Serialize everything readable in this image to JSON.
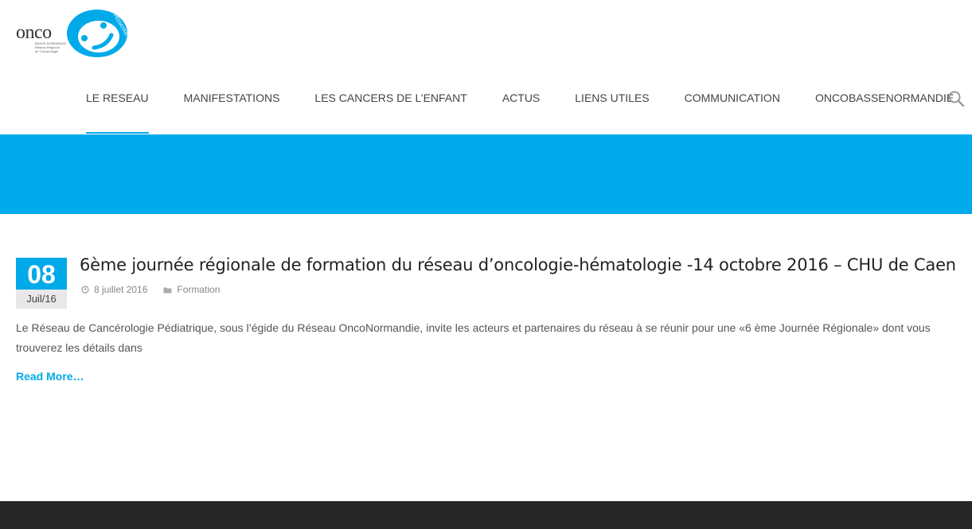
{
  "colors": {
    "accent": "#00aae9",
    "footer": "#262626",
    "band": "#00aaeb"
  },
  "logo": {
    "word": "onco",
    "sub_lines": [
      "BASSE-NORMANDIE",
      "Réseau Régional",
      "de Cancérologie"
    ],
    "badge": "PÉDIATRIE"
  },
  "nav": {
    "items": [
      {
        "label": "LE RESEAU",
        "active": true
      },
      {
        "label": "MANIFESTATIONS",
        "active": false
      },
      {
        "label": "LES CANCERS DE L’ENFANT",
        "active": false
      },
      {
        "label": "ACTUS",
        "active": false
      },
      {
        "label": "LIENS UTILES",
        "active": false
      },
      {
        "label": "COMMUNICATION",
        "active": false
      },
      {
        "label": "ONCOBASSENORMANDIE",
        "active": false
      }
    ],
    "search_icon": "search-icon"
  },
  "post": {
    "day": "08",
    "month": "Juil/16",
    "title": "6ème journée régionale de formation du réseau d’oncologie-hématologie -14 octobre 2016 – CHU de Caen",
    "date": "8 juillet 2016",
    "category": "Formation",
    "excerpt": "Le Réseau de Cancérologie Pédiatrique, sous l’égide du Réseau OncoNormandie, invite les acteurs et partenaires du réseau à se réunir pour une «6 ème Journée Régionale» dont vous trouverez les détails dans",
    "read_more": "Read More…"
  }
}
